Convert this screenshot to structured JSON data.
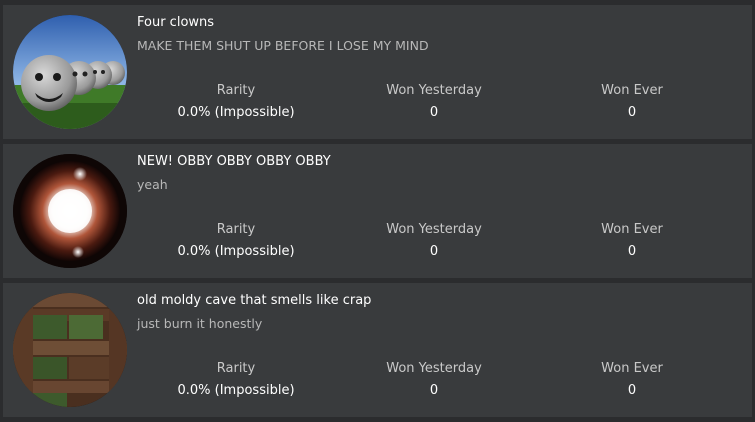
{
  "badges": [
    {
      "title": "Four clowns",
      "description": "MAKE THEM SHUT UP BEFORE I LOSE MY MIND",
      "thumbnail_icon": "clown-balls-image",
      "stats": {
        "rarity_label": "Rarity",
        "rarity_value": "0.0% (Impossible)",
        "won_yesterday_label": "Won Yesterday",
        "won_yesterday_value": "0",
        "won_ever_label": "Won Ever",
        "won_ever_value": "0"
      }
    },
    {
      "title": "NEW! OBBY OBBY OBBY OBBY",
      "description": "yeah",
      "thumbnail_icon": "glowing-orb-image",
      "stats": {
        "rarity_label": "Rarity",
        "rarity_value": "0.0% (Impossible)",
        "won_yesterday_label": "Won Yesterday",
        "won_yesterday_value": "0",
        "won_ever_label": "Won Ever",
        "won_ever_value": "0"
      }
    },
    {
      "title": "old moldy cave that smells like crap",
      "description": "just burn it honestly",
      "thumbnail_icon": "wood-bricks-image",
      "stats": {
        "rarity_label": "Rarity",
        "rarity_value": "0.0% (Impossible)",
        "won_yesterday_label": "Won Yesterday",
        "won_yesterday_value": "0",
        "won_ever_label": "Won Ever",
        "won_ever_value": "0"
      }
    }
  ],
  "colors": {
    "page_background": "#2b2c2e",
    "card_background": "#393b3d",
    "title_text": "#ffffff",
    "description_text": "#b8b8b8",
    "stat_label_text": "#c9c9c9"
  }
}
